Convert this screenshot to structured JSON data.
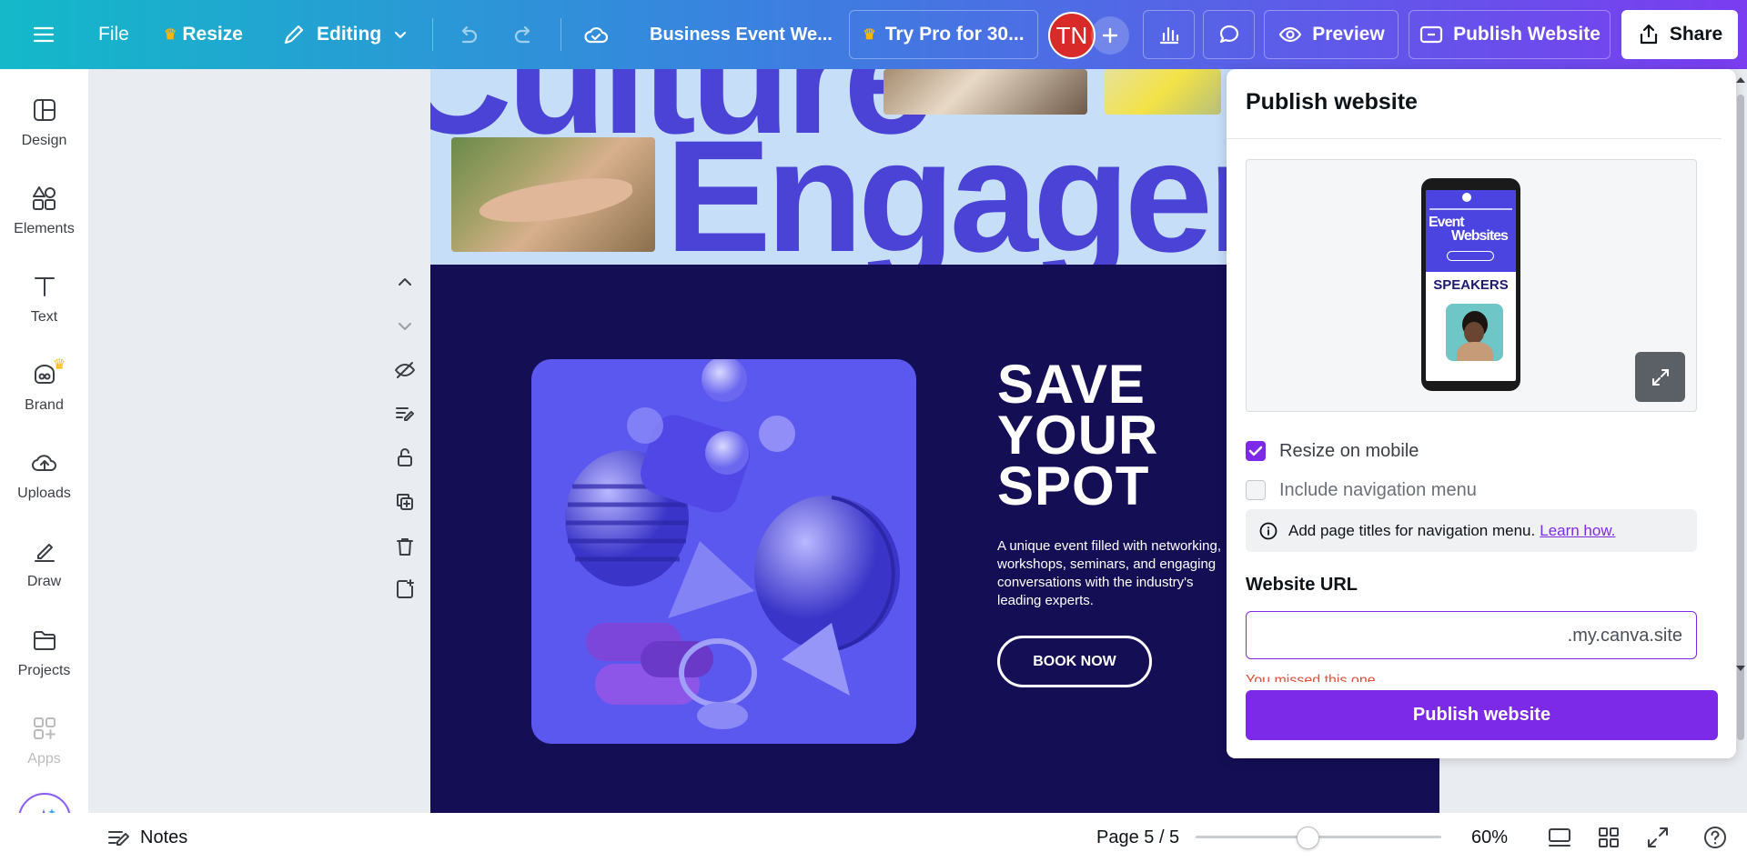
{
  "topbar": {
    "menu_icon": "hamburger-icon",
    "file_label": "File",
    "resize_label": "Resize",
    "editing_label": "Editing",
    "doc_title": "Business Event We...",
    "try_pro_label": "Try Pro for 30...",
    "avatar_initials": "TN",
    "preview_label": "Preview",
    "publish_label": "Publish Website",
    "share_label": "Share",
    "gradient": [
      "#13b9c9",
      "#3c7fe0",
      "#7a3df0"
    ]
  },
  "sidebar": {
    "items": [
      {
        "label": "Design",
        "icon": "design-icon"
      },
      {
        "label": "Elements",
        "icon": "elements-icon"
      },
      {
        "label": "Text",
        "icon": "text-icon"
      },
      {
        "label": "Brand",
        "icon": "brand-icon"
      },
      {
        "label": "Uploads",
        "icon": "uploads-icon"
      },
      {
        "label": "Draw",
        "icon": "draw-icon"
      },
      {
        "label": "Projects",
        "icon": "projects-icon"
      },
      {
        "label": "Apps",
        "icon": "apps-icon"
      }
    ]
  },
  "canvas": {
    "hero_word_top": "Culture",
    "hero_word_main": "Engagem",
    "save_line1": "SAVE",
    "save_line2": "YOUR",
    "save_line3": "SPOT",
    "description": "A unique event filled with networking, workshops, seminars, and engaging conversations with the industry's leading experts.",
    "book_label": "BOOK NOW",
    "colors": {
      "hero_bg": "#c7def8",
      "hero_text": "#4a43d6",
      "dark_bg": "#140e55",
      "art_bg": "#5a58ee"
    }
  },
  "panel": {
    "title": "Publish website",
    "phone_title_1": "Event",
    "phone_title_2": "Websites",
    "phone_speakers": "SPEAKERS",
    "resize_mobile_label": "Resize on mobile",
    "resize_mobile_checked": true,
    "nav_menu_label": "Include navigation menu",
    "nav_menu_checked": false,
    "info_text": "Add page titles for navigation menu.",
    "info_link": "Learn how.",
    "url_label": "Website URL",
    "url_value": "",
    "url_suffix": ".my.canva.site",
    "error_text": "You missed this one.",
    "publish_button": "Publish website",
    "accent": "#7d2ae8"
  },
  "bottombar": {
    "notes_label": "Notes",
    "page_indicator": "Page 5 / 5",
    "zoom_label": "60%",
    "zoom_value": 60
  }
}
